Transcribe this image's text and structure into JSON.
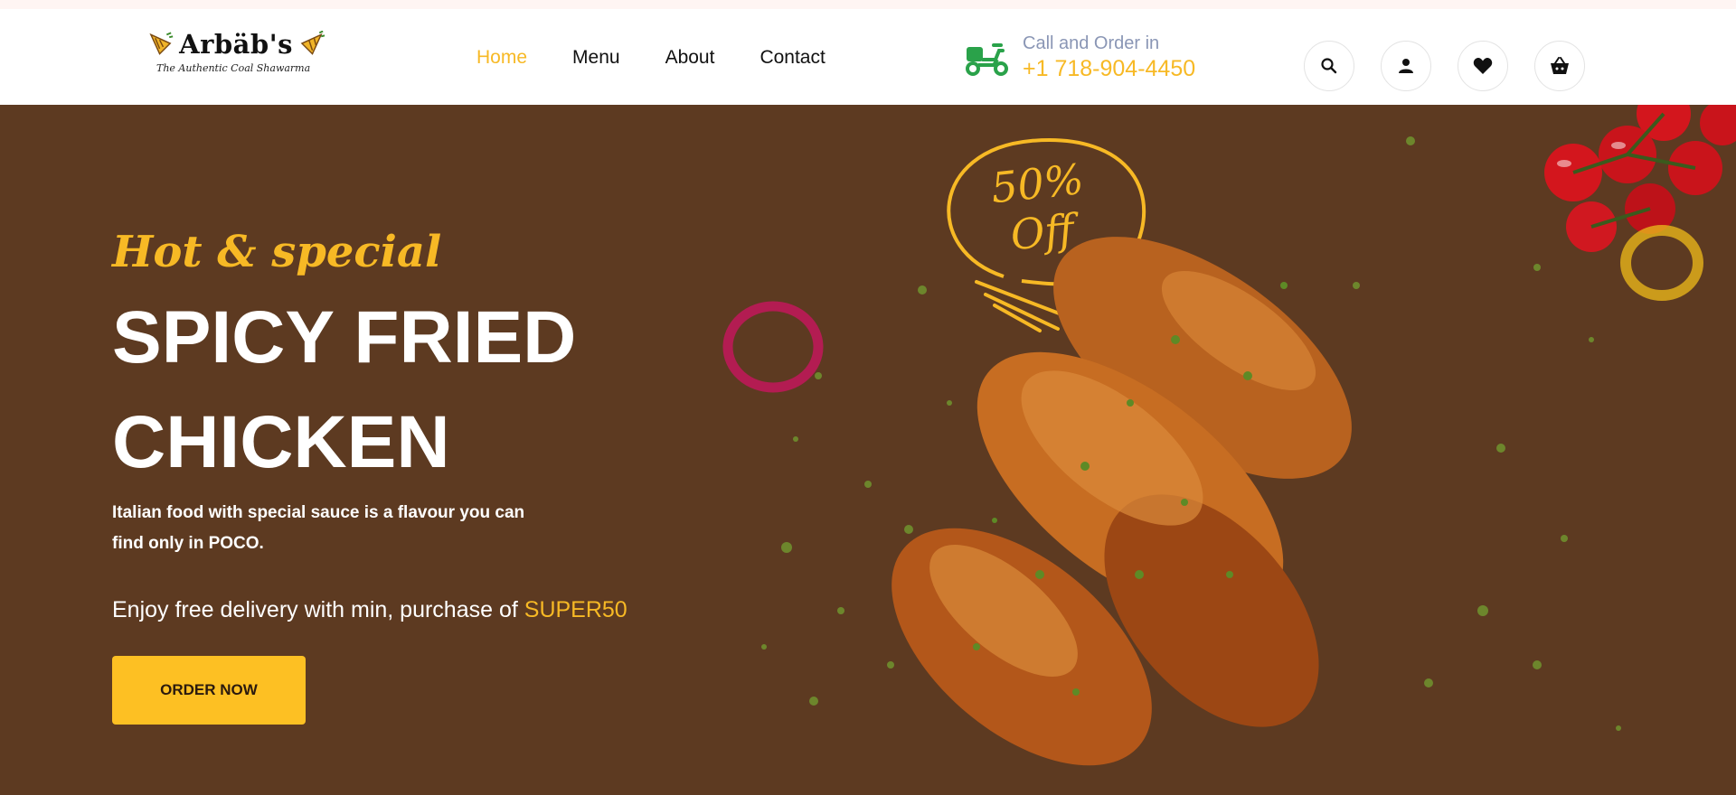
{
  "brand": {
    "name": "Arbäb's",
    "tagline": "The Authentic Coal Shawarma",
    "accent_color": "#f7b925",
    "hero_background": "#5d3a21",
    "button_color": "#fdc023"
  },
  "nav": {
    "items": [
      {
        "label": "Home",
        "active": true
      },
      {
        "label": "Menu",
        "active": false
      },
      {
        "label": "About",
        "active": false
      },
      {
        "label": "Contact",
        "active": false
      }
    ]
  },
  "call": {
    "icon": "delivery-scooter-icon",
    "label": "Call and Order in",
    "phone": "+1 718-904-4450"
  },
  "header_icons": [
    "search-icon",
    "user-icon",
    "heart-icon",
    "cart-icon"
  ],
  "hero": {
    "eyebrow": "Hot & special",
    "title_line1": "SPICY FRIED",
    "title_line2": "CHICKEN",
    "description": "Italian food with special sauce is a flavour you can find only in POCO.",
    "promo_text": "Enjoy free delivery with min, purchase of ",
    "promo_code": "SUPER50",
    "cta_label": "ORDER NOW",
    "offer_line1": "50%",
    "offer_line2": "Off"
  }
}
